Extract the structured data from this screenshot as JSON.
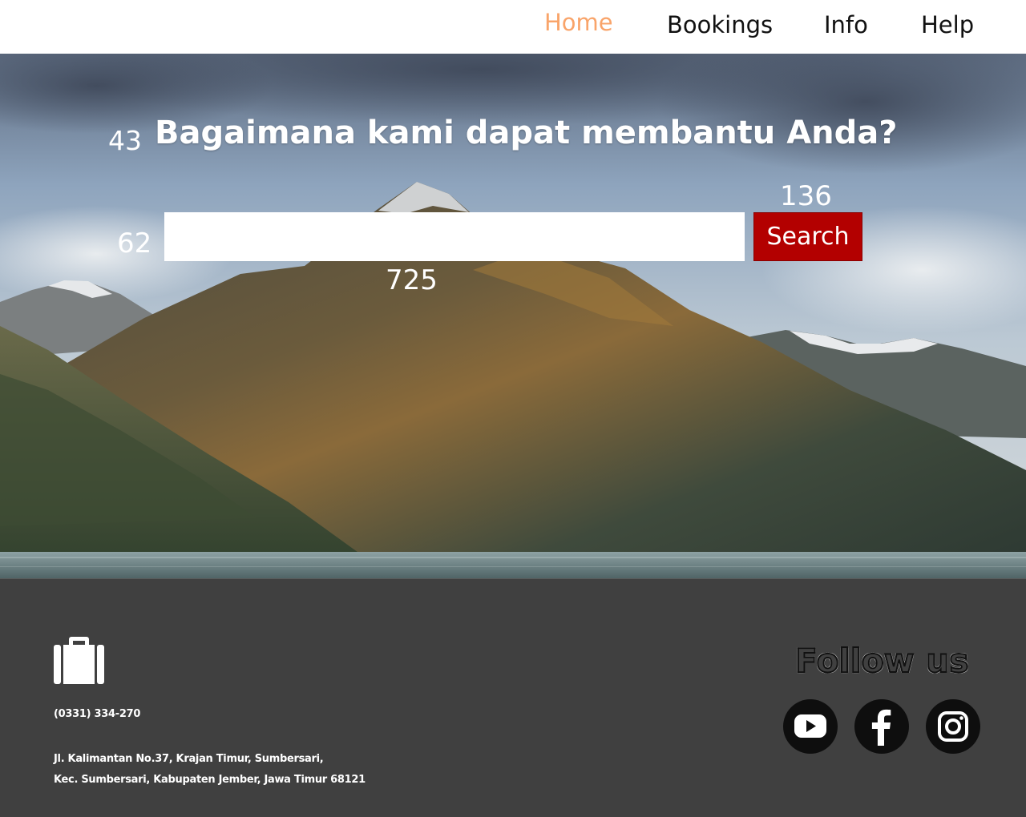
{
  "nav": {
    "items": [
      {
        "label": "Home",
        "active": true
      },
      {
        "label": "Bookings",
        "active": false
      },
      {
        "label": "Info",
        "active": false
      },
      {
        "label": "Help",
        "active": false
      }
    ],
    "active_color": "#f9a46a"
  },
  "hero": {
    "title": "Bagaimana kami dapat membantu Anda?",
    "number_labels": [
      "43",
      "62",
      "136",
      "725"
    ],
    "search": {
      "value": "",
      "placeholder": "",
      "button_label": "Search"
    },
    "button_color": "#b30000"
  },
  "footer": {
    "logo_icon": "briefcase-icon",
    "phone": "(0331) 334-270",
    "address_line1": "Jl. Kalimantan No.37, Krajan Timur, Sumbersari,",
    "address_line2": "Kec. Sumbersari, Kabupaten Jember, Jawa Timur 68121",
    "follow_title": "Follow us",
    "social": [
      {
        "icon": "youtube-icon"
      },
      {
        "icon": "facebook-icon"
      },
      {
        "icon": "instagram-icon"
      }
    ],
    "background": "#404040"
  }
}
